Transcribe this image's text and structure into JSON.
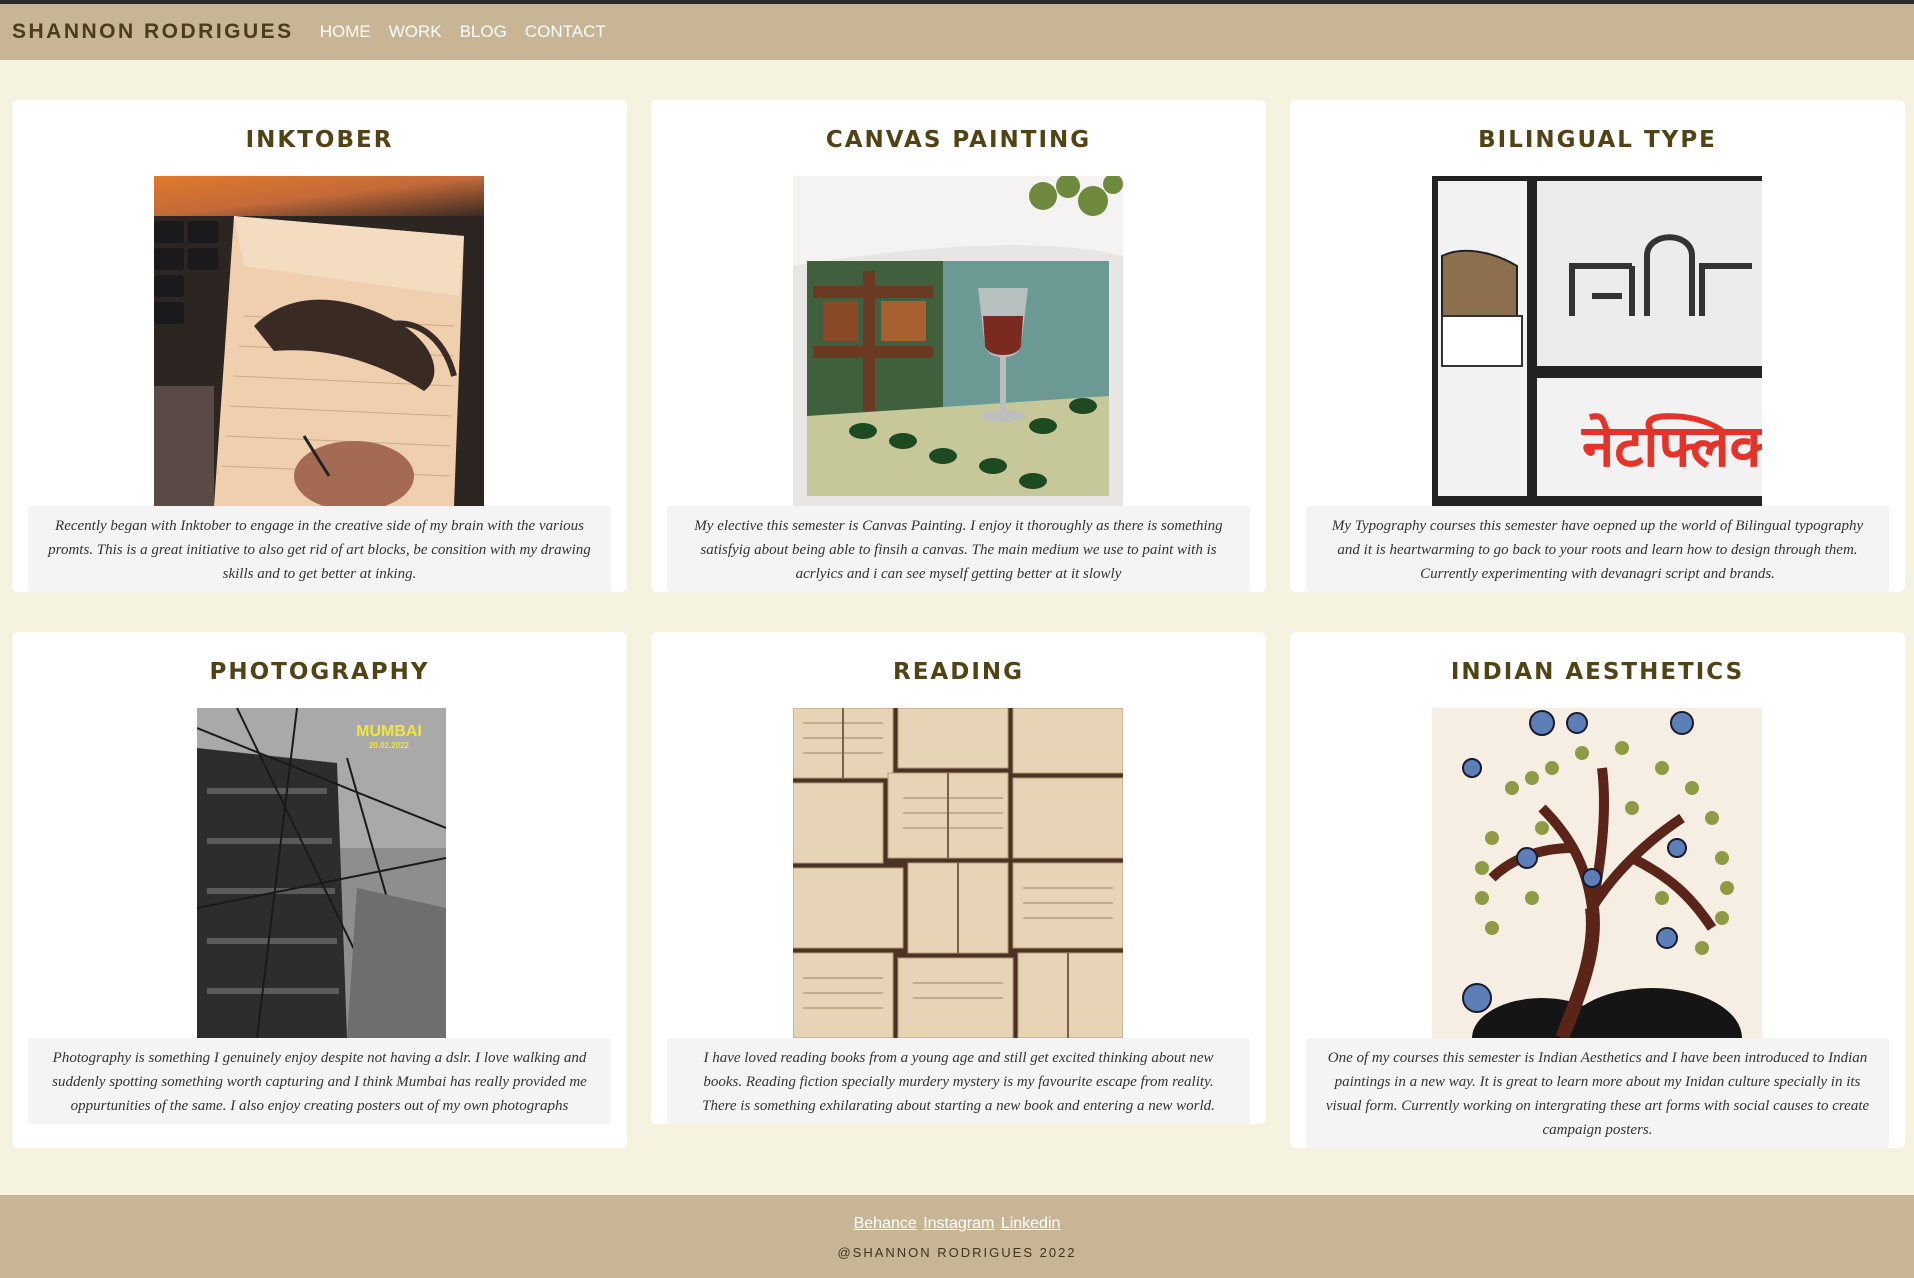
{
  "header": {
    "brand": "SHANNON RODRIGUES",
    "nav": [
      "HOME",
      "WORK",
      "BLOG",
      "CONTACT"
    ]
  },
  "cards": [
    {
      "title": "INKTOBER",
      "image": "inktober-sketchbook-photo",
      "desc": "Recently began with Inktober to engage in the creative side of my brain with the various promts. This is a great initiative to also get rid of art blocks, be consition with my drawing skills and to get better at inking."
    },
    {
      "title": "CANVAS PAINTING",
      "image": "canvas-painting-wine-glass",
      "desc": "My elective this semester is Canvas Painting. I enjoy it thoroughly as there is something satisfyig about being able to finsih a canvas. The main medium we use to paint with is acrlyics and i can see myself getting better at it slowly"
    },
    {
      "title": "BILINGUAL TYPE",
      "image": "bilingual-type-devanagari",
      "desc": "My Typography courses this semester have oepned up the world of Bilingual typography and it is heartwarming to go back to your roots and learn how to design through them. Currently experimenting with devanagri script and brands."
    },
    {
      "title": "PHOTOGRAPHY",
      "image": "mumbai-building-poster",
      "poster_title": "MUMBAI",
      "poster_date": "20.02.2022",
      "desc": "Photography is something I genuinely enjoy despite not having a dslr. I love walking and suddenly spotting something worth capturing and I think Mumbai has really provided me oppurtunities of the same. I also enjoy creating posters out of my own photographs"
    },
    {
      "title": "READING",
      "image": "open-books-collage",
      "desc": "I have loved reading books from a young age and still get excited thinking about new books. Reading fiction specially murdery mystery is my favourite escape from reality. There is something exhilarating about starting a new book and entering a new world."
    },
    {
      "title": "INDIAN AESTHETICS",
      "image": "indian-tree-painting",
      "desc": "One of my courses this semester is Indian Aesthetics and I have been introduced to Indian paintings in a new way. It is great to learn more about my Inidan culture specially in its visual form. Currently working on intergrating these art forms with social causes to create campaign posters."
    }
  ],
  "footer": {
    "links": [
      "Behance",
      "Instagram",
      "Linkedin"
    ],
    "copyright": "@SHANNON RODRIGUES 2022"
  }
}
